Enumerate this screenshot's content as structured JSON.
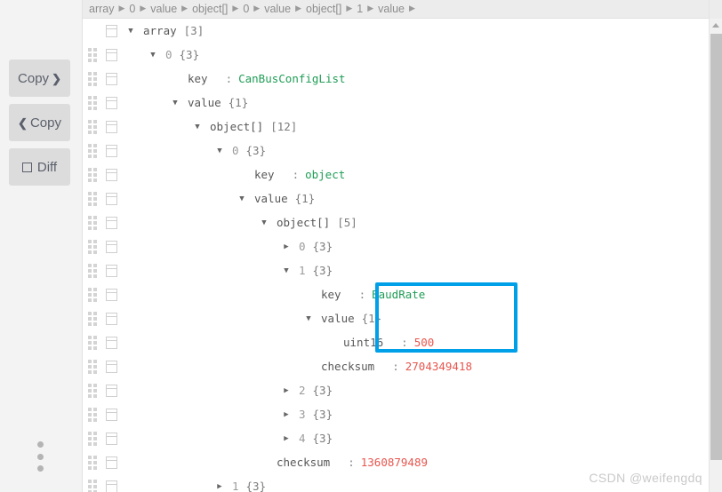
{
  "sidebar": {
    "buttons": [
      {
        "name": "copy-right",
        "label": "Copy",
        "icon": "chevron-right-icon",
        "chevron": "❯",
        "side": "right"
      },
      {
        "name": "copy-left",
        "label": "Copy",
        "icon": "chevron-left-icon",
        "chevron": "❮",
        "side": "left"
      },
      {
        "name": "diff",
        "label": "Diff",
        "icon": "checkbox-icon",
        "chevron": "",
        "side": "none"
      }
    ],
    "menu_handle": "vertical-dots-icon"
  },
  "breadcrumb": {
    "separator": "▶",
    "items": [
      "array",
      "0",
      "value",
      "object[]",
      "0",
      "value",
      "object[]",
      "1",
      "value"
    ],
    "trailing_separator": true
  },
  "tree": {
    "rows": [
      {
        "indent": 0,
        "toggle": "open",
        "label": "array",
        "count": "[3]"
      },
      {
        "indent": 1,
        "toggle": "open",
        "label": "0",
        "count": "{3}",
        "label_kind": "index"
      },
      {
        "indent": 2,
        "toggle": "none",
        "label": "key",
        "colon": ":",
        "value": "CanBusConfigList",
        "value_kind": "string"
      },
      {
        "indent": 2,
        "toggle": "open",
        "label": "value",
        "count": "{1}"
      },
      {
        "indent": 3,
        "toggle": "open",
        "label": "object[]",
        "count": "[12]"
      },
      {
        "indent": 4,
        "toggle": "open",
        "label": "0",
        "count": "{3}",
        "label_kind": "index"
      },
      {
        "indent": 5,
        "toggle": "none",
        "label": "key",
        "colon": ":",
        "value": "object",
        "value_kind": "string"
      },
      {
        "indent": 5,
        "toggle": "open",
        "label": "value",
        "count": "{1}"
      },
      {
        "indent": 6,
        "toggle": "open",
        "label": "object[]",
        "count": "[5]"
      },
      {
        "indent": 7,
        "toggle": "closed",
        "label": "0",
        "count": "{3}",
        "label_kind": "index"
      },
      {
        "indent": 7,
        "toggle": "open",
        "label": "1",
        "count": "{3}",
        "label_kind": "index"
      },
      {
        "indent": 8,
        "toggle": "none",
        "label": "key",
        "colon": ":",
        "value": "BaudRate",
        "value_kind": "string",
        "highlighted": true
      },
      {
        "indent": 8,
        "toggle": "open",
        "label": "value",
        "count": "{1}",
        "highlighted": true
      },
      {
        "indent": 9,
        "toggle": "none",
        "label": "uint16",
        "colon": ":",
        "value": "500",
        "value_kind": "number",
        "highlighted": true
      },
      {
        "indent": 8,
        "toggle": "none",
        "label": "checksum",
        "colon": ":",
        "value": "2704349418",
        "value_kind": "number"
      },
      {
        "indent": 7,
        "toggle": "closed",
        "label": "2",
        "count": "{3}",
        "label_kind": "index"
      },
      {
        "indent": 7,
        "toggle": "closed",
        "label": "3",
        "count": "{3}",
        "label_kind": "index"
      },
      {
        "indent": 7,
        "toggle": "closed",
        "label": "4",
        "count": "{3}",
        "label_kind": "index"
      },
      {
        "indent": 6,
        "toggle": "none",
        "label": "checksum",
        "colon": ":",
        "value": "1360879489",
        "value_kind": "number"
      },
      {
        "indent": 4,
        "toggle": "closed",
        "label": "1",
        "count": "{3}",
        "label_kind": "index"
      }
    ],
    "toggle_glyphs": {
      "open": "▼",
      "closed": "▶"
    }
  },
  "highlight": {
    "color": "#00a0e9",
    "label": "baud-rate-highlight"
  },
  "colors": {
    "string_value": "#1f9d55",
    "number_value": "#e8554e",
    "label": "#585858",
    "index": "#9b9b9b",
    "accent": "#00a0e9"
  },
  "watermark": {
    "text": "CSDN @weifengdq"
  },
  "scrollbar": {
    "up_arrow": "scroll-up-arrow-icon"
  }
}
